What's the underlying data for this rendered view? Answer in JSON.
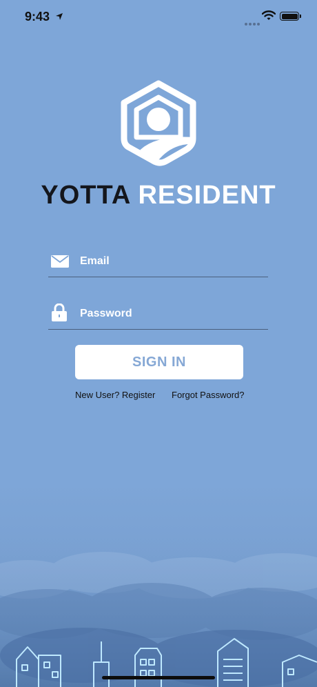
{
  "status_bar": {
    "time": "9:43",
    "icons": [
      "location-arrow-icon",
      "signal-dots-icon",
      "wifi-icon",
      "battery-icon"
    ]
  },
  "brand": {
    "name_dark": "YOTTA",
    "name_light": "RESIDENT",
    "colors": {
      "dark": "#14161c",
      "light": "#ffffff",
      "background": "#7ea6d8"
    }
  },
  "form": {
    "email_placeholder": "Email",
    "password_placeholder": "Password",
    "signin_label": "SIGN IN"
  },
  "links": {
    "register": "New User? Register",
    "forgot": "Forgot Password?"
  }
}
